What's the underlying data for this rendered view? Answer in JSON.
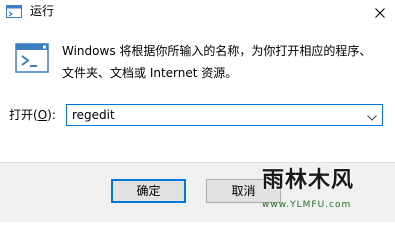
{
  "window": {
    "title": "运行",
    "close_icon": "close-icon",
    "app_icon": "run-icon"
  },
  "description": {
    "line1": "Windows 将根据你所输入的名称，为你打开相应的程序、",
    "line2": "文件夹、文档或 Internet 资源。"
  },
  "open_field": {
    "label_prefix": "打开(",
    "label_key": "O",
    "label_suffix": "):",
    "value": "regedit",
    "dropdown_icon": "chevron-down-icon"
  },
  "buttons": {
    "ok": "确定",
    "cancel": "取消"
  },
  "watermark": {
    "text": "雨林木风",
    "url": "www.YLMFU.com"
  },
  "colors": {
    "accent": "#0078d7",
    "footer_bg": "#f0f0f0",
    "button_bg": "#e1e1e1"
  }
}
